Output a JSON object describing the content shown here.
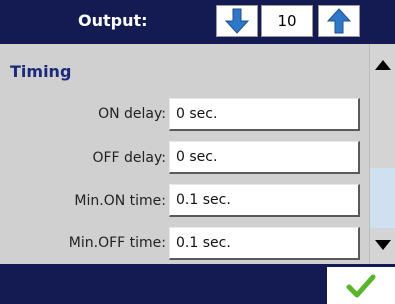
{
  "header": {
    "title": "Output:",
    "value": "10",
    "down_icon": "arrow-down-icon",
    "up_icon": "arrow-up-icon"
  },
  "section": {
    "title": "Timing"
  },
  "rows": [
    {
      "label": "ON  delay:",
      "value": "0 sec."
    },
    {
      "label": "OFF delay:",
      "value": "0 sec."
    },
    {
      "label": "Min.ON time:",
      "value": "0.1 sec."
    },
    {
      "label": "Min.OFF time:",
      "value": "0.1 sec."
    }
  ],
  "scrollbar": {
    "up_icon": "scroll-up-triangle-icon",
    "down_icon": "scroll-down-triangle-icon"
  },
  "footer": {
    "ok_icon": "checkmark-icon"
  },
  "colors": {
    "header_bg": "#141b52",
    "arrow_blue": "#2f78c8",
    "section_title": "#1b2a7a",
    "check_green": "#5ab52a"
  }
}
